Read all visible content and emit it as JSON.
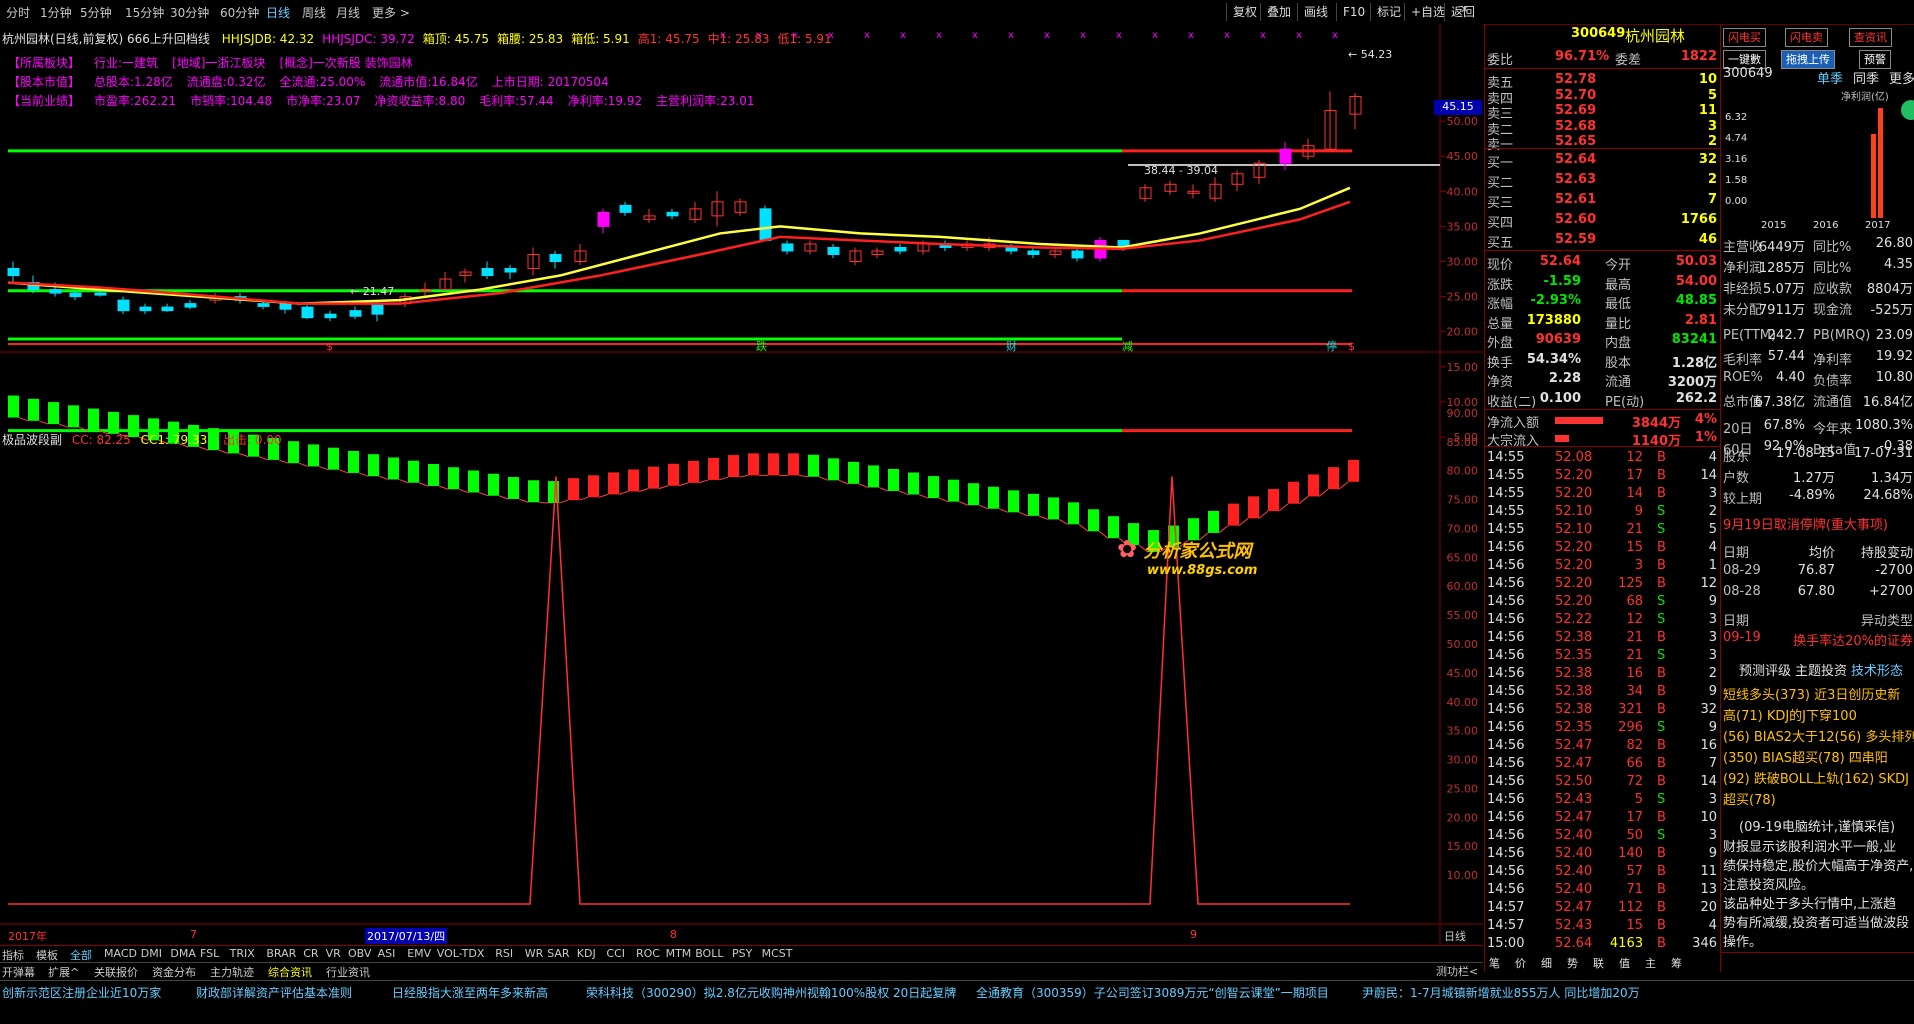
{
  "topbar": {
    "timeframes": [
      "分时",
      "1分钟",
      "5分钟",
      "15分钟",
      "30分钟",
      "60分钟",
      "日线",
      "周线",
      "月线",
      "更多 >"
    ],
    "selected_timeframe": "日线",
    "tools": [
      "复权",
      "叠加",
      "画线",
      "F10",
      "标记",
      "+自选",
      "返回"
    ]
  },
  "chart": {
    "title": "杭州园林(日线,前复权) 666上升回档线",
    "indicators": [
      {
        "text": "HHJSJDB: 42.32",
        "color": "#ffff00"
      },
      {
        "text": "HHJSJDC: 39.72",
        "color": "#ff00ff"
      },
      {
        "text": "箱顶: 45.75",
        "color": "#ffff00"
      },
      {
        "text": "箱腰: 25.83",
        "color": "#ffff00"
      },
      {
        "text": "箱低: 5.91",
        "color": "#ffff00"
      },
      {
        "text": "高1: 45.75",
        "color": "#ff3232"
      },
      {
        "text": "中1: 25.83",
        "color": "#ff3232"
      },
      {
        "text": "低1: 5.91",
        "color": "#ff3232"
      }
    ],
    "info": {
      "row1": [
        "【所属板块】",
        "行业:一建筑",
        "[地域]一浙江板块",
        "[概念]一次新股 装饰园林"
      ],
      "row2": [
        "【股本市值】",
        "总股本:1.28亿",
        "流通盘:0.32亿",
        "全流通:25.00%",
        "流通市值:16.84亿",
        "上市日期: 20170504"
      ],
      "row3": [
        "【当前业绩】",
        "市盈率:262.21",
        "市销率:104.48",
        "市净率:23.07",
        "净资收益率:8.80",
        "毛利率:57.44",
        "净利率:19.92",
        "主营利润率:23.01"
      ]
    },
    "price_axis": [
      "50.00",
      "45.00",
      "40.00",
      "35.00",
      "30.00",
      "25.00",
      "20.00",
      "15.00",
      "10.00",
      "5.00"
    ],
    "price_marker": "45.15",
    "range_label": "38.44 - 39.04",
    "high_label": "54.23",
    "low_label": "21.47",
    "bottom_markers": [
      {
        "text": "$",
        "color": "#ff3232"
      },
      {
        "text": "跌",
        "color": "#00ff00"
      },
      {
        "text": "财",
        "color": "#00e0e0"
      },
      {
        "text": "减",
        "color": "#00ff00"
      },
      {
        "text": "停",
        "color": "#00e0e0"
      },
      {
        "text": "$",
        "color": "#ff3232"
      }
    ],
    "sub_title": "极品波段副",
    "sub_cc": "CC: 82.25",
    "sub_cc1": "CC1: 79.33",
    "sub_out": "出击: 0.00",
    "sub_axis": [
      "90.00",
      "85.00",
      "80.00",
      "75.00",
      "70.00",
      "65.00",
      "60.00",
      "55.00",
      "50.00",
      "45.00",
      "40.00",
      "35.00",
      "30.00",
      "25.00",
      "20.00",
      "15.00",
      "10.00"
    ],
    "date_axis": [
      "2017年",
      "7",
      "2017/07/13/四",
      "8",
      "9"
    ],
    "date_axis_label": "日线",
    "watermark": "分析家公式网",
    "watermark_url": "www.88gs.com"
  },
  "chart_data": {
    "type": "candlestick",
    "ylim": [
      5,
      55
    ],
    "hlines": [
      {
        "value": 45.75,
        "label": "高1"
      },
      {
        "value": 25.83,
        "label": "中1"
      },
      {
        "value": 5.91,
        "label": "低1"
      }
    ]
  },
  "bottom_tabs": [
    "指标",
    "模板",
    "全部",
    "MACD",
    "DMI",
    "DMA",
    "FSL",
    "TRIX",
    "BRAR",
    "CR",
    "VR",
    "OBV",
    "ASI",
    "EMV",
    "VOL-TDX",
    "RSI",
    "WR",
    "SAR",
    "KDJ",
    "CCI",
    "ROC",
    "MTM",
    "BOLL",
    "PSY",
    "MCST"
  ],
  "bottom_tabs2": [
    "开弹幕",
    "扩展^",
    "关联报价",
    "资金分布",
    "主力轨迹",
    "综合资讯",
    "行业资讯"
  ],
  "bottom_right": "测功栏<",
  "ticker": [
    "创新示范区注册企业近10万家",
    "财政部详解资产评估基本准则",
    "日经股指大涨至两年多来新高",
    "荣科科技（300290）拟2.8亿元收购神州视翰100%股权 20日起复牌",
    "全通教育（300359）子公司签订3089万元“创智云课堂”一期项目",
    "尹蔚民：1-7月城镇新增就业855万人 同比增加20万"
  ],
  "quote": {
    "code": "300649",
    "name": "杭州园林",
    "weibi_label": "委比",
    "weibi": "96.71%",
    "weicha_label": "委差",
    "weicha": "1822",
    "sells": [
      {
        "label": "卖五",
        "price": "52.78",
        "vol": "10"
      },
      {
        "label": "卖四",
        "price": "52.70",
        "vol": "5"
      },
      {
        "label": "卖三",
        "price": "52.69",
        "vol": "11"
      },
      {
        "label": "卖二",
        "price": "52.68",
        "vol": "3"
      },
      {
        "label": "卖一",
        "price": "52.65",
        "vol": "2"
      }
    ],
    "buys": [
      {
        "label": "买一",
        "price": "52.64",
        "vol": "32"
      },
      {
        "label": "买二",
        "price": "52.63",
        "vol": "2"
      },
      {
        "label": "买三",
        "price": "52.61",
        "vol": "7"
      },
      {
        "label": "买四",
        "price": "52.60",
        "vol": "1766"
      },
      {
        "label": "买五",
        "price": "52.59",
        "vol": "46"
      }
    ],
    "stats": [
      {
        "l1": "现价",
        "v1": "52.64",
        "c1": "#ff3232",
        "l2": "今开",
        "v2": "50.03",
        "c2": "#ff3232"
      },
      {
        "l1": "涨跌",
        "v1": "-1.59",
        "c1": "#00e600",
        "l2": "最高",
        "v2": "54.00",
        "c2": "#ff3232"
      },
      {
        "l1": "涨幅",
        "v1": "-2.93%",
        "c1": "#00e600",
        "l2": "最低",
        "v2": "48.85",
        "c2": "#00e600"
      },
      {
        "l1": "总量",
        "v1": "173880",
        "c1": "#ffff00",
        "l2": "量比",
        "v2": "2.81",
        "c2": "#ff3232"
      },
      {
        "l1": "外盘",
        "v1": "90639",
        "c1": "#ff3232",
        "l2": "内盘",
        "v2": "83241",
        "c2": "#00e600"
      },
      {
        "l1": "换手",
        "v1": "54.34%",
        "c1": "#e0e0e0",
        "l2": "股本",
        "v2": "1.28亿",
        "c2": "#e0e0e0"
      },
      {
        "l1": "净资",
        "v1": "2.28",
        "c1": "#e0e0e0",
        "l2": "流通",
        "v2": "3200万",
        "c2": "#e0e0e0"
      },
      {
        "l1": "收益(二)",
        "v1": "0.100",
        "c1": "#e0e0e0",
        "l2": "PE(动)",
        "v2": "262.2",
        "c2": "#e0e0e0"
      }
    ],
    "flow": [
      {
        "label": "净流入额",
        "val": "3844万",
        "pct": "4%"
      },
      {
        "label": "大宗流入",
        "val": "1140万",
        "pct": "1%"
      }
    ],
    "ticks": [
      {
        "t": "14:55",
        "p": "52.08",
        "v": "12",
        "d": "B",
        "n": "4"
      },
      {
        "t": "14:55",
        "p": "52.20",
        "v": "17",
        "d": "B",
        "n": "14"
      },
      {
        "t": "14:55",
        "p": "52.20",
        "v": "14",
        "d": "B",
        "n": "3"
      },
      {
        "t": "14:55",
        "p": "52.10",
        "v": "9",
        "d": "S",
        "n": "2"
      },
      {
        "t": "14:55",
        "p": "52.10",
        "v": "21",
        "d": "S",
        "n": "5"
      },
      {
        "t": "14:56",
        "p": "52.20",
        "v": "15",
        "d": "B",
        "n": "4"
      },
      {
        "t": "14:56",
        "p": "52.20",
        "v": "3",
        "d": "B",
        "n": "1"
      },
      {
        "t": "14:56",
        "p": "52.20",
        "v": "125",
        "d": "B",
        "n": "12"
      },
      {
        "t": "14:56",
        "p": "52.20",
        "v": "68",
        "d": "S",
        "n": "9"
      },
      {
        "t": "14:56",
        "p": "52.22",
        "v": "12",
        "d": "S",
        "n": "3"
      },
      {
        "t": "14:56",
        "p": "52.38",
        "v": "21",
        "d": "B",
        "n": "3"
      },
      {
        "t": "14:56",
        "p": "52.35",
        "v": "21",
        "d": "S",
        "n": "3"
      },
      {
        "t": "14:56",
        "p": "52.38",
        "v": "16",
        "d": "B",
        "n": "2"
      },
      {
        "t": "14:56",
        "p": "52.38",
        "v": "34",
        "d": "B",
        "n": "9"
      },
      {
        "t": "14:56",
        "p": "52.38",
        "v": "321",
        "d": "B",
        "n": "32"
      },
      {
        "t": "14:56",
        "p": "52.35",
        "v": "296",
        "d": "S",
        "n": "9"
      },
      {
        "t": "14:56",
        "p": "52.47",
        "v": "82",
        "d": "B",
        "n": "16"
      },
      {
        "t": "14:56",
        "p": "52.47",
        "v": "66",
        "d": "B",
        "n": "7"
      },
      {
        "t": "14:56",
        "p": "52.50",
        "v": "72",
        "d": "B",
        "n": "14"
      },
      {
        "t": "14:56",
        "p": "52.43",
        "v": "5",
        "d": "S",
        "n": "3"
      },
      {
        "t": "14:56",
        "p": "52.47",
        "v": "17",
        "d": "B",
        "n": "10"
      },
      {
        "t": "14:56",
        "p": "52.40",
        "v": "50",
        "d": "S",
        "n": "3"
      },
      {
        "t": "14:56",
        "p": "52.40",
        "v": "140",
        "d": "B",
        "n": "9"
      },
      {
        "t": "14:56",
        "p": "52.40",
        "v": "57",
        "d": "B",
        "n": "11"
      },
      {
        "t": "14:56",
        "p": "52.40",
        "v": "71",
        "d": "B",
        "n": "13"
      },
      {
        "t": "14:57",
        "p": "52.47",
        "v": "112",
        "d": "B",
        "n": "20"
      },
      {
        "t": "14:57",
        "p": "52.43",
        "v": "15",
        "d": "B",
        "n": "4"
      },
      {
        "t": "15:00",
        "p": "52.64",
        "v": "4163",
        "d": "B",
        "n": "346"
      }
    ]
  },
  "right_panel": {
    "buttons": [
      "闪电买",
      "闪电卖",
      "查资讯",
      "一键數",
      "拖拽上传",
      "预警"
    ],
    "code": "300649",
    "tabs": [
      "单季",
      "同季",
      "更多.."
    ],
    "chart_title": "净利润(亿)",
    "chart_y": [
      "6.32",
      "4.74",
      "3.16",
      "1.58",
      "0.00"
    ],
    "chart_x": [
      "2015",
      "2016",
      "2017"
    ],
    "fin": [
      {
        "l": "主营收",
        "v": "6449万",
        "l2": "同比%",
        "v2": "26.80"
      },
      {
        "l": "净利润",
        "v": "1285万",
        "l2": "同比%",
        "v2": "4.35"
      },
      {
        "l": "非经损",
        "v": "5.07万",
        "l2": "应收款",
        "v2": "8804万"
      },
      {
        "l": "未分配",
        "v": "7911万",
        "l2": "现金流",
        "v2": "-525万"
      },
      {
        "l": "PE(TTM)",
        "v": "242.7",
        "l2": "PB(MRQ)",
        "v2": "23.09"
      },
      {
        "l": "毛利率",
        "v": "57.44",
        "l2": "净利率",
        "v2": "19.92"
      },
      {
        "l": "ROE%",
        "v": "4.40",
        "l2": "负债率",
        "v2": "10.80"
      },
      {
        "l": "总市值",
        "v": "67.38亿",
        "l2": "流通值",
        "v2": "16.84亿"
      },
      {
        "l": "20日",
        "v": "67.8%",
        "l2": "今年来",
        "v2": "1080.3%"
      },
      {
        "l": "60日",
        "v": "92.0%",
        "l2": "Beta值",
        "v2": "-0.38"
      }
    ],
    "holder": [
      {
        "l": "股东",
        "v": "17-08-15",
        "v2": "17-07-31"
      },
      {
        "l": "户数",
        "v": "1.27万",
        "v2": "1.34万"
      },
      {
        "l": "较上期",
        "v": "-4.89%",
        "v2": "24.68%"
      }
    ],
    "notice": "9月19日取消停牌(重大事项)",
    "block": [
      {
        "l": "日期",
        "v": "均价",
        "v2": "持股变动"
      },
      {
        "l": "08-29",
        "v": "76.87",
        "v2": "-2700"
      },
      {
        "l": "08-28",
        "v": "67.80",
        "v2": "+2700"
      }
    ],
    "abnormal_head": [
      "日期",
      "异动类型"
    ],
    "abnormal": [
      "09-19",
      "换手率达20%的证券"
    ],
    "diag_tabs": [
      "预测评级",
      "主题投资",
      "技术形态"
    ],
    "diag_lines": [
      "短线多头(373) 近3日创历史新",
      "高(71) KDJ的J下穿100",
      "(56) BIAS2大于12(56) 多头排列",
      "(350) BIAS超买(78) 四串阳",
      "(92) 跌破BOLL上轨(162) SKDJ",
      "超买(78)"
    ],
    "comment_title": "(09-19电脑统计,谨慎采信)",
    "comment": [
      "财报显示该股利润水平一般,业",
      "绩保持稳定,股价大幅高于净资产,",
      "注意投资风险。",
      "该品种处于多头行情中,上涨趋",
      "势有所减缓,投资者可适当做波段",
      "操作。"
    ],
    "bottom_tabs": [
      "笔",
      "价",
      "细",
      "势",
      "联",
      "值",
      "主",
      "筹"
    ]
  }
}
